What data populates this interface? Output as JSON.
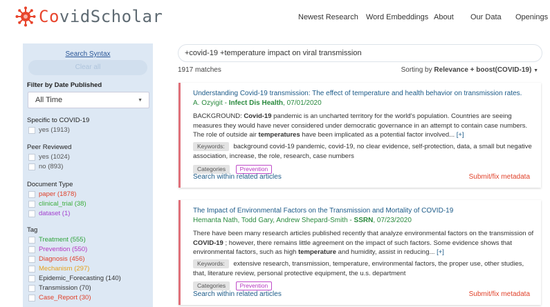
{
  "header": {
    "logo_text": "CovidScholar",
    "nav": [
      {
        "label": "Newest Research"
      },
      {
        "label": "Word Embeddings"
      },
      {
        "label": "About"
      },
      {
        "label": "Our Data"
      },
      {
        "label": "Openings"
      }
    ]
  },
  "sidebar": {
    "search_syntax": "Search Syntax",
    "clear_all": "Clear all",
    "filter_date_title": "Filter by Date Published",
    "date_value": "All Time",
    "specific_title": "Specific to COVID-19",
    "specific_items": [
      {
        "label": "yes (1913)"
      }
    ],
    "peer_title": "Peer Reviewed",
    "peer_items": [
      {
        "label": "yes (1024)"
      },
      {
        "label": "no (893)"
      }
    ],
    "doctype_title": "Document Type",
    "doctype_items": [
      {
        "label": "paper (1878)",
        "color": "#e0412a"
      },
      {
        "label": "clinical_trial (38)",
        "color": "#3cae3c"
      },
      {
        "label": "dataset (1)",
        "color": "#a33fcf"
      }
    ],
    "tag_title": "Tag",
    "tag_items": [
      {
        "label": "Treatment (555)",
        "color": "#2fa33b"
      },
      {
        "label": "Prevention (550)",
        "color": "#b535c0"
      },
      {
        "label": "Diagnosis (456)",
        "color": "#e0412a"
      },
      {
        "label": "Mechanism (297)",
        "color": "#e6a21c"
      },
      {
        "label": "Epidemic_Forecasting (140)",
        "color": "#333333"
      },
      {
        "label": "Transmission (70)",
        "color": "#333333"
      },
      {
        "label": "Case_Report (30)",
        "color": "#e0412a"
      }
    ]
  },
  "search": {
    "query": "+covid-19 +temperature impact on viral transmission"
  },
  "results": {
    "count": "1917",
    "matches_label": "matches",
    "sort_prefix": "Sorting by",
    "sort_value": "Relevance + boost(COVID-19)",
    "items": [
      {
        "title": "Understanding Covid-19 transmission: The effect of temperature and health behavior on transmission rates.",
        "authors": "A. Ozyigit - ",
        "source": "Infect Dis Health",
        "date": ", 07/01/2020",
        "abstract_html": "BACKGROUND: <b>Covid-19</b> pandemic is an uncharted territory for the world's population. Countries are seeing measures they would have never considered under democratic governance in an attempt to contain case numbers. The role of outside air <b>temperatures</b> have been implicated as a potential factor involved... <span style=\"color:#1b5a88\">[+]</span>",
        "keywords_label": "Keywords:",
        "keywords": "background covid-19 pandemic, covid-19, no clear evidence, self-protection, data, a small but negative association, increase, the role, research, case numbers",
        "categories_label": "Categories",
        "category": "Prevention",
        "related": "Search within related articles",
        "fix": "Submit/fix metadata"
      },
      {
        "title": "The Impact of Environmental Factors on the Transmission and Mortality of COVID-19",
        "authors": "Hemanta Nath, Todd Gary, Andrew Shepard-Smith - ",
        "source": "SSRN",
        "date": ", 07/23/2020",
        "abstract_html": "There have been many research articles published recently that analyze environmental factors on the transmission of <b>COVID-19</b> ; however, there remains little agreement on the impact of such factors. Some evidence shows that environmental factors, such as high <b>temperature</b> and humidity, assist in reducing... <span style=\"color:#1b5a88\">[+]</span>",
        "keywords_label": "Keywords:",
        "keywords": "extensive research, transmission, temperature, environmental factors, the proper use, other studies, that, literature review, personal protective equipment, the u.s. department",
        "categories_label": "Categories",
        "category": "Prevention",
        "related": "Search within related articles",
        "fix": "Submit/fix metadata"
      }
    ]
  },
  "colors": {
    "accent_blue": "#1b5a88",
    "author_green": "#2a8a3e",
    "alert_red": "#e0412a",
    "sidebar_bg": "#dde8f4",
    "logo_red": "#e8452d"
  }
}
